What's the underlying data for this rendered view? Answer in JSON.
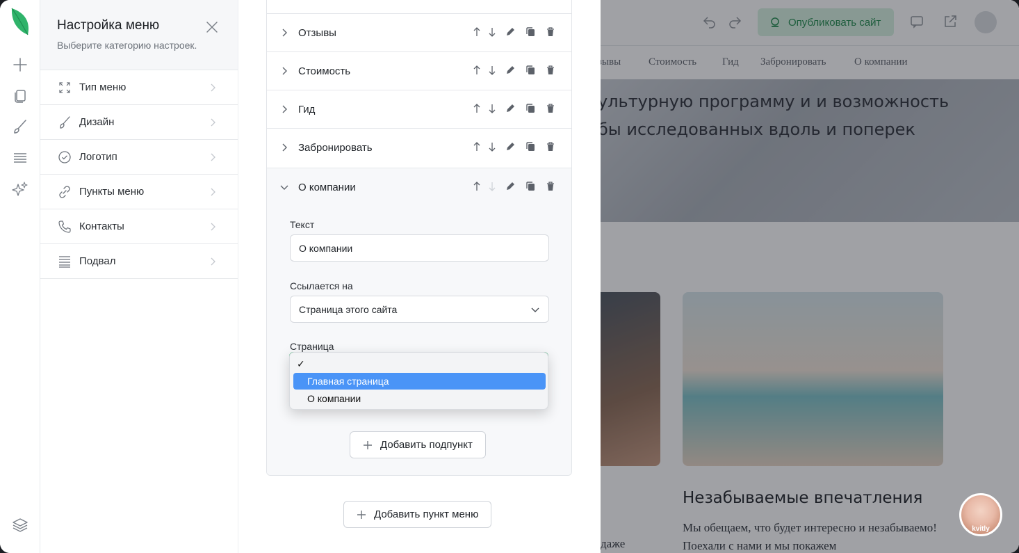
{
  "settings": {
    "title": "Настройка меню",
    "subtitle": "Выберите категорию настроек.",
    "categories": [
      {
        "label": "Тип меню",
        "icon": "expand-icon"
      },
      {
        "label": "Дизайн",
        "icon": "brush-icon"
      },
      {
        "label": "Логотип",
        "icon": "check-circle-icon"
      },
      {
        "label": "Пункты меню",
        "icon": "link-icon"
      },
      {
        "label": "Контакты",
        "icon": "phone-icon"
      },
      {
        "label": "Подвал",
        "icon": "footer-icon"
      }
    ]
  },
  "menu": {
    "items": [
      {
        "label": "Отзывы"
      },
      {
        "label": "Стоимость"
      },
      {
        "label": "Гид"
      },
      {
        "label": "Забронировать"
      },
      {
        "label": "О компании",
        "expanded": true
      }
    ],
    "editor": {
      "text_label": "Текст",
      "text_value": "О компании",
      "link_label": "Ссылается на",
      "link_value": "Страница этого сайта",
      "page_label": "Страница",
      "dropdown": {
        "selected_mark": "✓",
        "options": [
          "Главная страница",
          "О компании"
        ],
        "highlighted": "Главная страница"
      },
      "add_subitem": "Добавить подпункт"
    },
    "add_item": "Добавить пункт меню"
  },
  "preview": {
    "publish_label": "Опубликовать сайт",
    "nav": [
      "зывы",
      "Стоимость",
      "Гид",
      "Забронировать",
      "О компании"
    ],
    "hero_lines": [
      "ультурную программу и и возможность",
      "бы исследованных вдоль и поперек"
    ],
    "card_title": "Незабываемые впечатления",
    "card_text": "Мы обещаем, что будет интересно и незабываемо! Поехали с нами и мы покажем",
    "side_text": "даже",
    "chat_caption": "kvitly"
  },
  "colors": {
    "brand_green": "#2fb36a",
    "publish_bg": "#d6f2e0",
    "highlight_blue": "#4a94f7"
  }
}
